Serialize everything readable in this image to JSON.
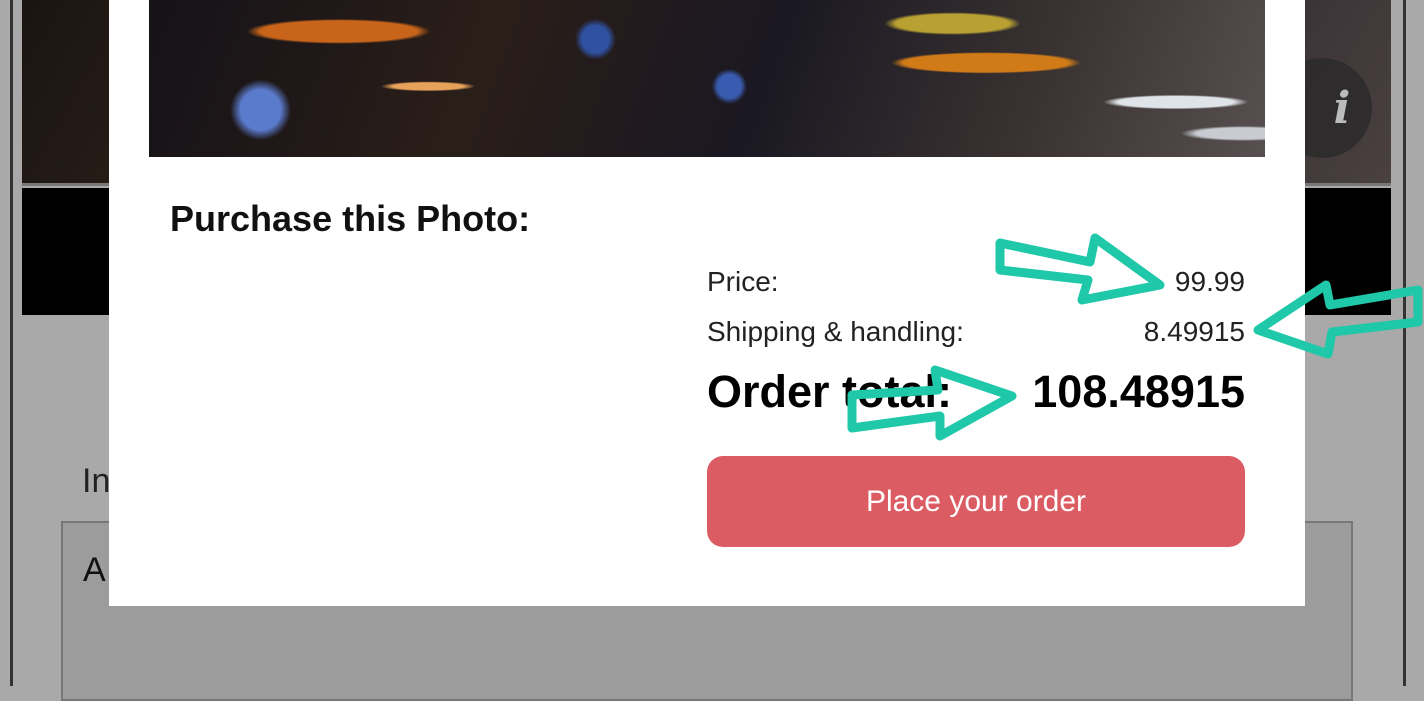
{
  "background": {
    "info_icon": "i",
    "field_label_fragment": "In",
    "field_text_fragment": "A"
  },
  "modal": {
    "title": "Purchase this Photo:",
    "price_label": "Price:",
    "price_value": "99.99",
    "shipping_label": "Shipping & handling:",
    "shipping_value": "8.49915",
    "total_label": "Order total:",
    "total_value": "108.48915",
    "order_button_label": "Place your order"
  },
  "colors": {
    "button_bg": "#dc5c63",
    "annotation_arrow": "#1ec8a8"
  },
  "icons": [
    "info-icon",
    "annotation-arrow-icon"
  ]
}
